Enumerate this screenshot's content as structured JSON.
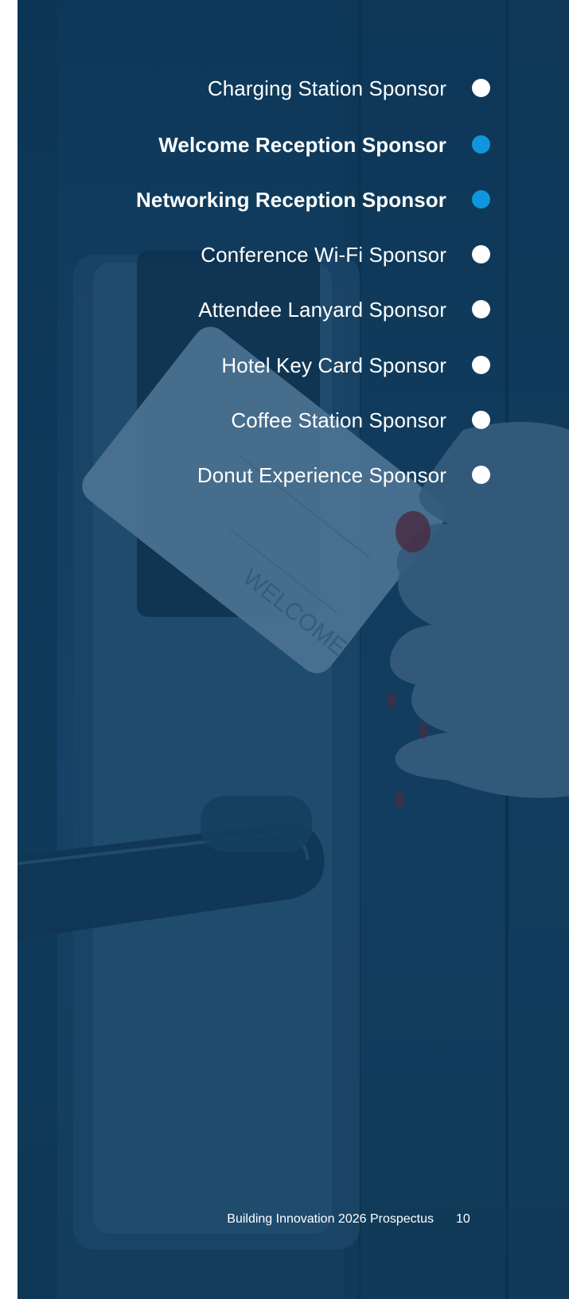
{
  "menu": {
    "items": [
      {
        "label": "Charging Station Sponsor",
        "bold": false,
        "dot_color": "#ffffff"
      },
      {
        "label": "Welcome Reception Sponsor",
        "bold": true,
        "dot_color": "#0f96dd"
      },
      {
        "label": "Networking Reception Sponsor",
        "bold": true,
        "dot_color": "#0f96dd"
      },
      {
        "label": "Conference Wi-Fi Sponsor",
        "bold": false,
        "dot_color": "#ffffff"
      },
      {
        "label": "Attendee Lanyard Sponsor",
        "bold": false,
        "dot_color": "#ffffff"
      },
      {
        "label": "Hotel Key Card Sponsor",
        "bold": false,
        "dot_color": "#ffffff"
      },
      {
        "label": "Coffee Station Sponsor",
        "bold": false,
        "dot_color": "#ffffff"
      },
      {
        "label": "Donut Experience Sponsor",
        "bold": false,
        "dot_color": "#ffffff"
      }
    ]
  },
  "background": {
    "description_icon": "hotel-key-card-photo",
    "overlay_color": "#164569"
  },
  "card": {
    "text": "WELCOME"
  },
  "footer": {
    "title": "Building Innovation 2026 Prospectus",
    "page_number": "10"
  }
}
